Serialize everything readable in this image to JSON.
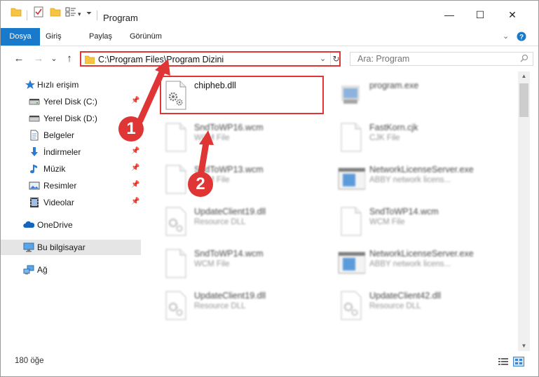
{
  "window": {
    "title": "Program",
    "minimize": "—",
    "maximize": "☐",
    "close": "✕"
  },
  "ribbon": {
    "tabs": [
      "Dosya",
      "Giriş",
      "Paylaş",
      "Görünüm"
    ]
  },
  "navbar": {
    "back": "←",
    "forward": "→",
    "recent": "⌄",
    "up": "↑",
    "address": "C:\\Program Files\\Program Dizini",
    "search_placeholder": "Ara: Program"
  },
  "sidebar": {
    "items": [
      {
        "label": "Hızlı erişim",
        "icon": "star-icon",
        "pinned": false
      },
      {
        "label": "Yerel Disk (C:)",
        "icon": "drive-icon",
        "pinned": true
      },
      {
        "label": "Yerel Disk (D:)",
        "icon": "drive-icon",
        "pinned": false
      },
      {
        "label": "Belgeler",
        "icon": "documents-icon",
        "pinned": true
      },
      {
        "label": "İndirmeler",
        "icon": "download-icon",
        "pinned": true
      },
      {
        "label": "Müzik",
        "icon": "music-icon",
        "pinned": true
      },
      {
        "label": "Resimler",
        "icon": "pictures-icon",
        "pinned": true
      },
      {
        "label": "Videolar",
        "icon": "video-icon",
        "pinned": true
      },
      {
        "label": "OneDrive",
        "icon": "cloud-icon",
        "pinned": false
      },
      {
        "label": "Bu bilgisayar",
        "icon": "computer-icon",
        "pinned": false,
        "selected": true
      },
      {
        "label": "Ağ",
        "icon": "network-icon",
        "pinned": false
      }
    ],
    "pin_glyph": "📌"
  },
  "files": [
    {
      "name": "chipheb.dll",
      "type": "",
      "icon": "dll-gear-icon",
      "highlighted": true
    },
    {
      "name": "program.exe",
      "type": "",
      "icon": "exe-app-icon"
    },
    {
      "name": "SndToWP16.wcm",
      "type": "WCM File",
      "icon": "blank-file-icon"
    },
    {
      "name": "FastKorn.cjk",
      "type": "CJK File",
      "icon": "blank-file-icon"
    },
    {
      "name": "SndToWP13.wcm",
      "type": "WCM File",
      "icon": "blank-file-icon"
    },
    {
      "name": "NetworkLicenseServer.exe",
      "type": "ABBY network licens...",
      "icon": "window-app-icon"
    },
    {
      "name": "UpdateClient19.dll",
      "type": "Resource DLL",
      "icon": "dll-gear-icon"
    },
    {
      "name": "SndToWP14.wcm",
      "type": "WCM File",
      "icon": "blank-file-icon"
    },
    {
      "name": "SndToWP14.wcm",
      "type": "WCM File",
      "icon": "blank-file-icon"
    },
    {
      "name": "NetworkLicenseServer.exe",
      "type": "ABBY network licens...",
      "icon": "window-app-icon"
    },
    {
      "name": "UpdateClient19.dll",
      "type": "Resource DLL",
      "icon": "dll-gear-icon"
    },
    {
      "name": "UpdateClient42.dll",
      "type": "Resource DLL",
      "icon": "dll-gear-icon"
    }
  ],
  "annotations": {
    "step1": "1",
    "step2": "2",
    "color": "#e03535"
  },
  "status": {
    "count": "180 öğe"
  },
  "colors": {
    "accent": "#1979ca",
    "highlight": "#e03535",
    "folder": "#f5c443"
  }
}
